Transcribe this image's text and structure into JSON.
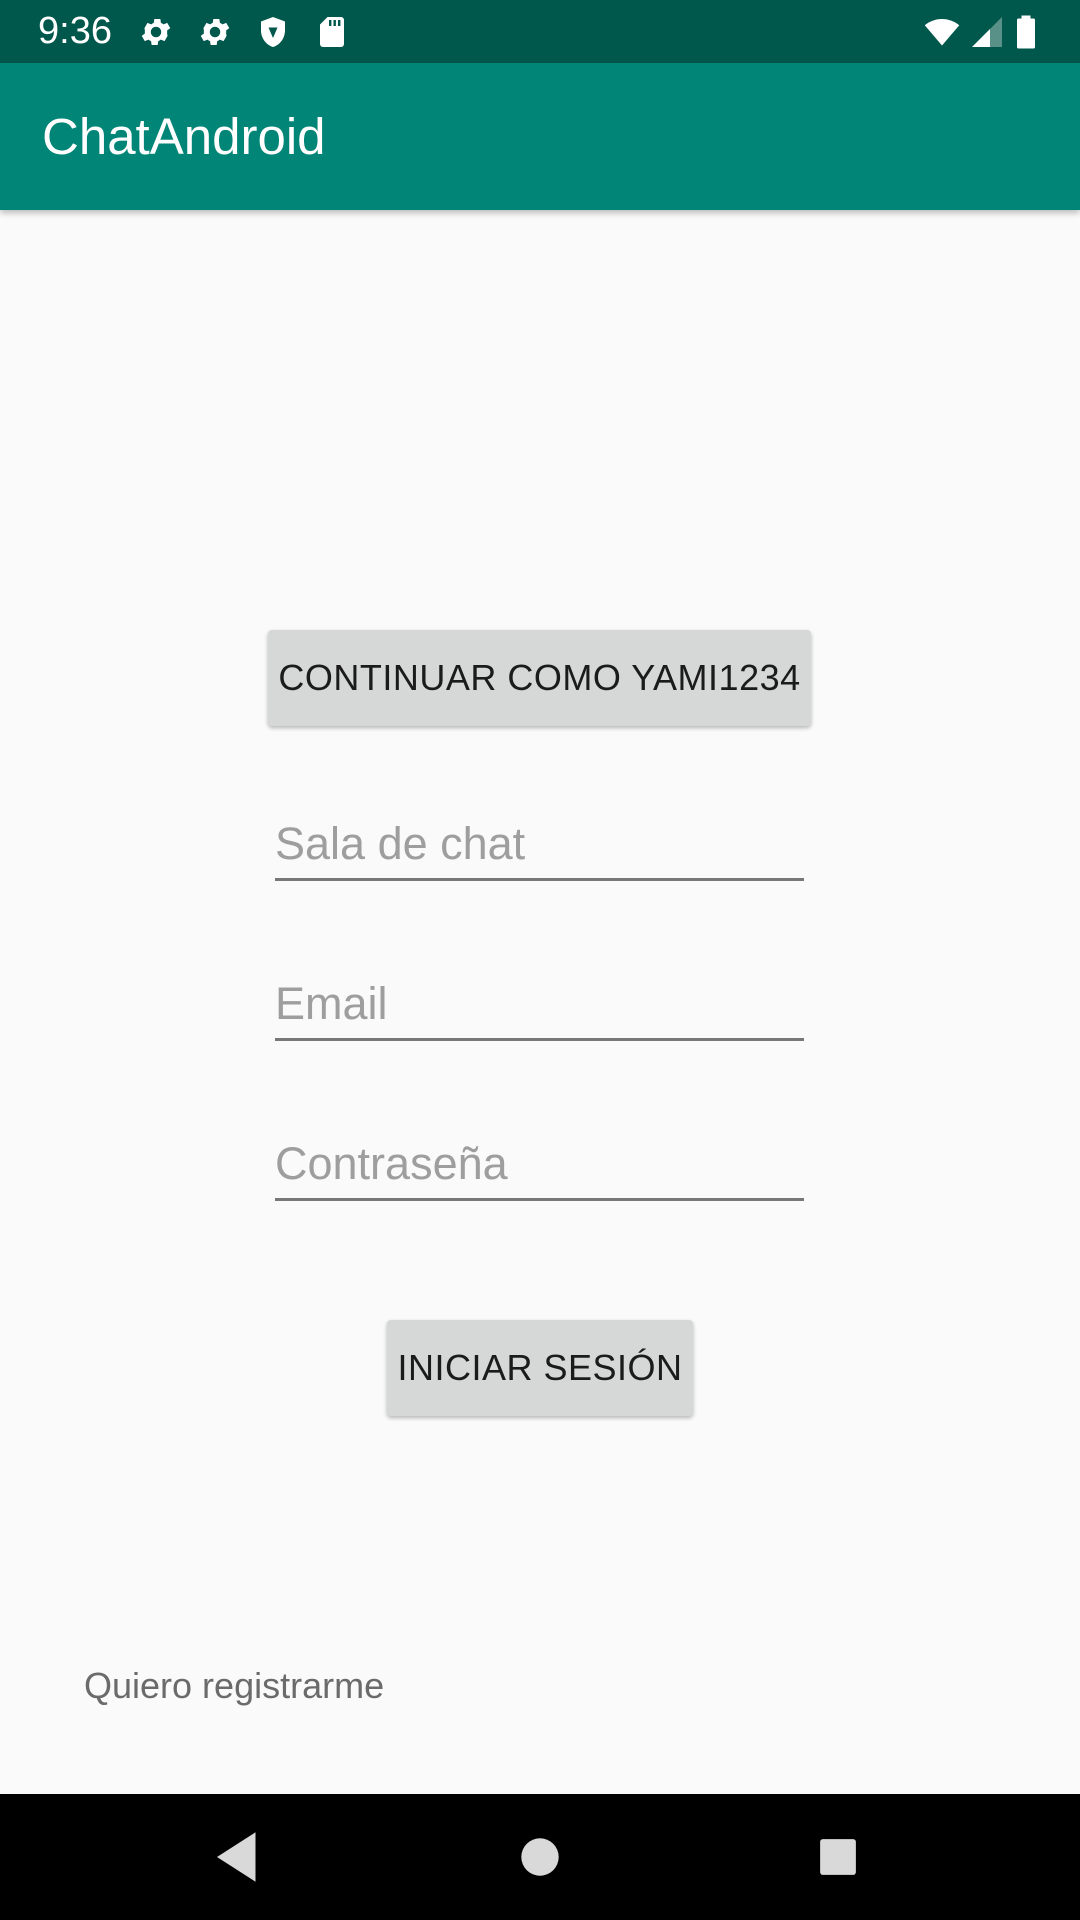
{
  "status_bar": {
    "time": "9:36",
    "icons": [
      "settings-icon",
      "settings-icon",
      "shield-icon",
      "sd-card-icon",
      "wifi-icon",
      "signal-icon",
      "battery-icon"
    ],
    "background": "#00574b"
  },
  "app_bar": {
    "title": "ChatAndroid",
    "background": "#008577"
  },
  "main": {
    "continue_button": "CONTINUAR COMO YAMI1234",
    "chat_room_placeholder": "Sala de chat",
    "email_placeholder": "Email",
    "password_placeholder": "Contraseña",
    "login_button": "INICIAR SESIÓN",
    "register_link": "Quiero registrarme"
  },
  "nav_bar": {
    "icons": [
      "back-icon",
      "home-icon",
      "recents-icon"
    ]
  }
}
